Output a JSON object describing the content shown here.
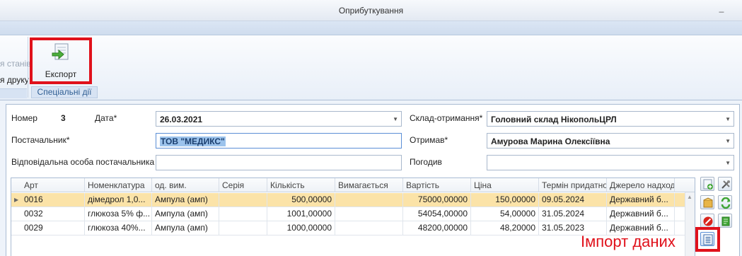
{
  "window": {
    "title": "Оприбуткування"
  },
  "ribbon": {
    "cut_label_top": "я станів",
    "cut_label_bottom": "я друку",
    "export_label": "Експорт",
    "group_label": "Спеціальні дії"
  },
  "form": {
    "number_label": "Номер",
    "number_value": "3",
    "date_label": "Дата*",
    "date_value": "26.03.2021",
    "warehouse_label": "Склад-отримання*",
    "warehouse_value": "Головний склад НікопольЦРЛ",
    "supplier_label": "Постачальник*",
    "supplier_value": "ТОВ \"МЕДИКС\"",
    "receiver_label": "Отримав*",
    "receiver_value": "Амурова Марина Олексіївна",
    "responsible_label": "Відповідальна особа постачальника",
    "responsible_value": "",
    "approved_label": "Погодив",
    "approved_value": ""
  },
  "grid": {
    "columns": [
      "Арт",
      "Номенклатура",
      "од. вим.",
      "Серія",
      "Кількість",
      "Вимагається",
      "Вартість",
      "Ціна",
      "Термін придатнос",
      "Джерело надходж"
    ],
    "rows": [
      [
        "0016",
        "дімедрол 1,0...",
        "Ампула (амп)",
        "",
        "500,00000",
        "",
        "75000,00000",
        "150,00000",
        "09.05.2024",
        "Державний б..."
      ],
      [
        "0032",
        "глюкоза 5% ф...",
        "Ампула (амп)",
        "",
        "1001,00000",
        "",
        "54054,00000",
        "54,00000",
        "31.05.2024",
        "Державний б..."
      ],
      [
        "0029",
        "глюкоза 40%...",
        "Ампула (амп)",
        "",
        "1000,00000",
        "",
        "48200,00000",
        "48,20000",
        "31.05.2023",
        "Державний б..."
      ]
    ]
  },
  "annotation": {
    "import_label": "Імпорт даних"
  },
  "colors": {
    "highlight": "#e0111b",
    "selected_row": "#fbe3a8",
    "group_label": "#2f5e93"
  },
  "icons": [
    "minimize-icon",
    "export-icon",
    "add-row-icon",
    "settings-icon",
    "package-icon",
    "refresh-icon",
    "delete-icon",
    "flag-icon",
    "import-data-icon"
  ]
}
